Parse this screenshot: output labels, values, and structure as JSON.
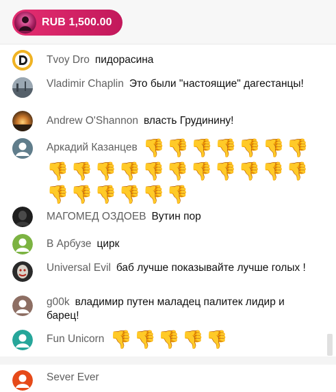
{
  "superchat": {
    "amount": "RUB 1,500.00",
    "color_start": "#e52e71",
    "color_end": "#c2185b"
  },
  "messages": [
    {
      "author": "Tvoy Dro",
      "text": "пидорасина",
      "avatar_icon": "letter-d-avatar"
    },
    {
      "author": "Vladimir Chaplin",
      "text": "Это были \"настоящие\" дагестанцы!",
      "avatar_icon": "photo-avatar"
    },
    {
      "author": "Andrew O'Shannon",
      "text": "власть Грудинину!",
      "avatar_icon": "sunset-avatar"
    },
    {
      "author": "Аркадий Казанцев",
      "text": "",
      "emoji": "👎",
      "emoji_count": 24,
      "avatar_icon": "default-avatar"
    },
    {
      "author": "МАГОМЕД ОЗДОЕВ",
      "text": "Вутин пор",
      "avatar_icon": "dark-photo-avatar"
    },
    {
      "author": "В Арбузе",
      "text": "цирк",
      "avatar_icon": "default-avatar"
    },
    {
      "author": "Universal Evil",
      "text": "баб лучше показывайте лучше голых !",
      "avatar_icon": "clown-avatar"
    },
    {
      "author": "g00k",
      "text": "владимир путен маладец палитек лидир и барец!",
      "avatar_icon": "default-avatar"
    },
    {
      "author": "Fun Unicorn",
      "text": "",
      "emoji": "👎",
      "emoji_count": 5,
      "avatar_icon": "default-avatar"
    }
  ],
  "bottom_message": {
    "author": "Sever Ever",
    "avatar_icon": "default-avatar"
  }
}
